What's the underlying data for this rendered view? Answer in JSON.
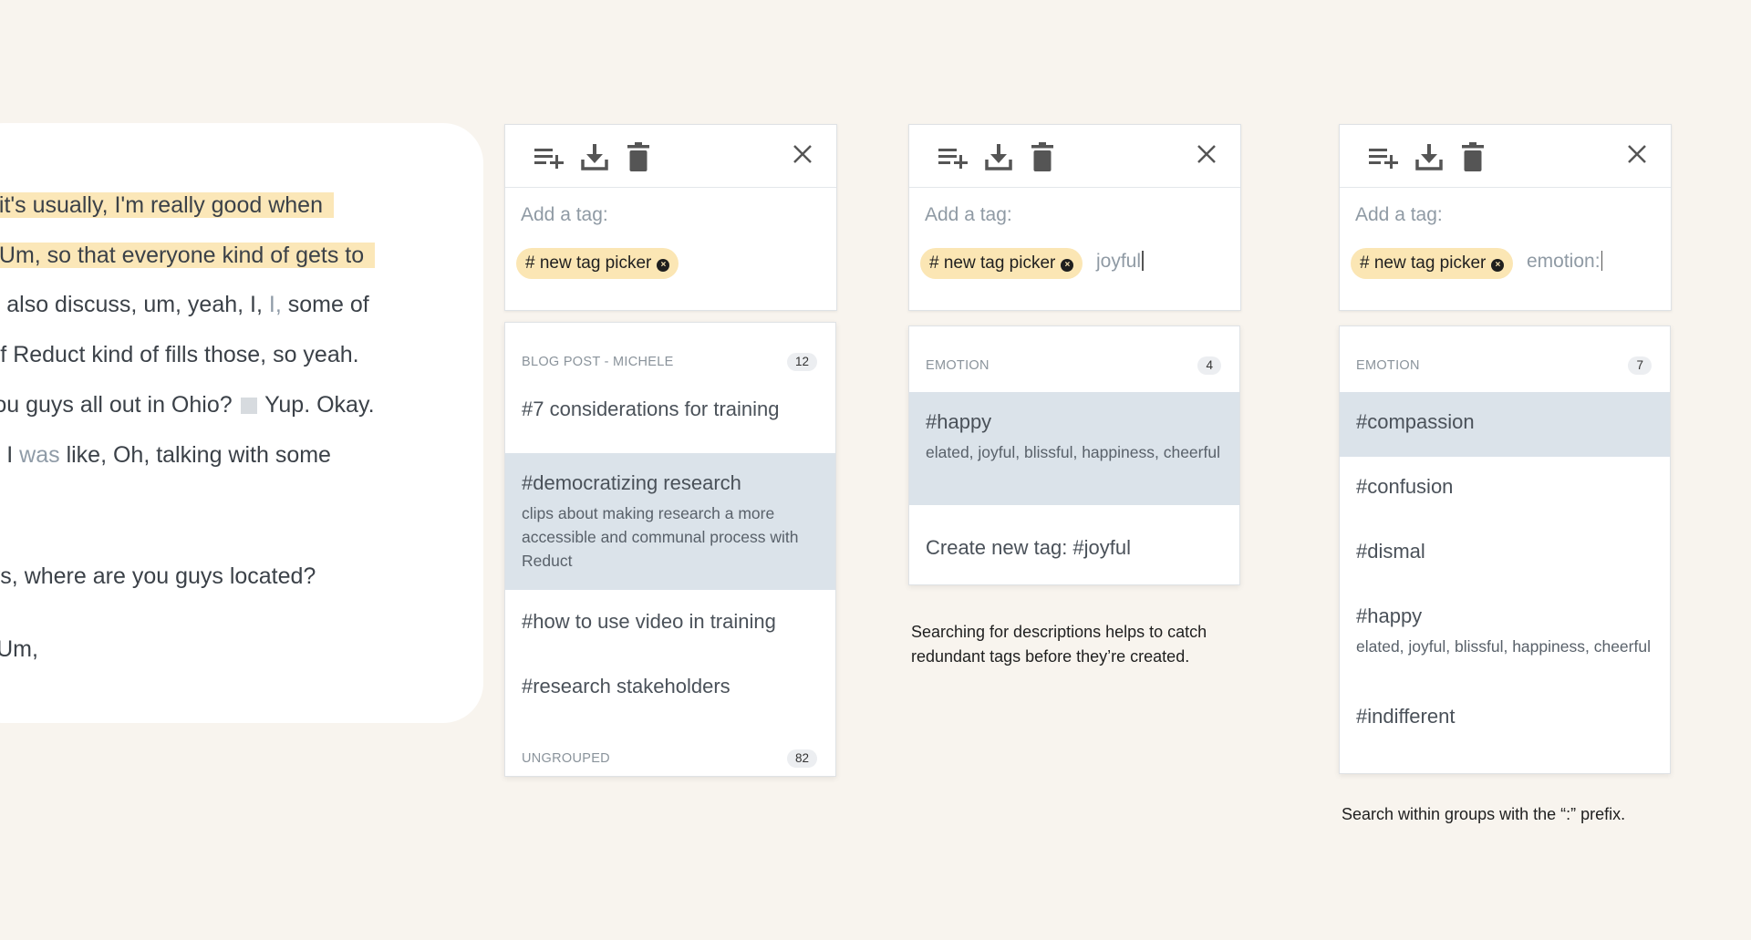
{
  "transcript": {
    "lines": [
      "ink it's usually, I'm really good when",
      "all. Um, so that everyone kind of gets to",
      "can also discuss, um, yeah, I,",
      "I,",
      "some of",
      "ee if Reduct kind of fills those, so yeah.",
      "e you guys all out in Ohio?",
      "Yup. Okay.",
      ", so I",
      "was",
      "like, Oh, talking with some",
      "guys, where are you guys located?",
      "re. Um,"
    ]
  },
  "tag_picker": {
    "add_label": "Add a tag:",
    "chip_label": "# new tag picker",
    "chip_remove": "×",
    "toolbar_icons": [
      "playlist-add-icon",
      "download-icon",
      "trash-icon",
      "close-icon"
    ]
  },
  "panel1": {
    "groups": [
      {
        "name": "BLOG POST - MICHELE",
        "count": "12"
      },
      {
        "name": "UNGROUPED",
        "count": "82"
      }
    ],
    "items": [
      {
        "name": "#7 considerations for training",
        "desc": ""
      },
      {
        "name": "#democratizing research",
        "desc": "clips about making research a more accessible and communal process with Reduct"
      },
      {
        "name": "#how to use video in training",
        "desc": ""
      },
      {
        "name": "#research stakeholders",
        "desc": ""
      }
    ]
  },
  "panel2": {
    "query": "joyful",
    "group": {
      "name": "EMOTION",
      "count": "4"
    },
    "items": [
      {
        "name": "#happy",
        "desc": "elated, joyful, blissful, happiness, cheerful"
      },
      {
        "name": "Create new tag: #joyful",
        "desc": ""
      }
    ],
    "caption": "Searching for descriptions helps to catch redundant tags before they’re created."
  },
  "panel3": {
    "query": "emotion:",
    "group": {
      "name": "EMOTION",
      "count": "7"
    },
    "items": [
      {
        "name": "#compassion",
        "desc": ""
      },
      {
        "name": "#confusion",
        "desc": ""
      },
      {
        "name": "#dismal",
        "desc": ""
      },
      {
        "name": "#happy",
        "desc": "elated, joyful, blissful, happiness, cheerful"
      },
      {
        "name": "#indifferent",
        "desc": ""
      }
    ],
    "caption": "Search within groups with the “:” prefix."
  },
  "colors": {
    "background": "#f8f4ee",
    "highlight": "#fbe7b8",
    "chip": "#fbe6b4",
    "selected_row": "#dbe3ea"
  }
}
